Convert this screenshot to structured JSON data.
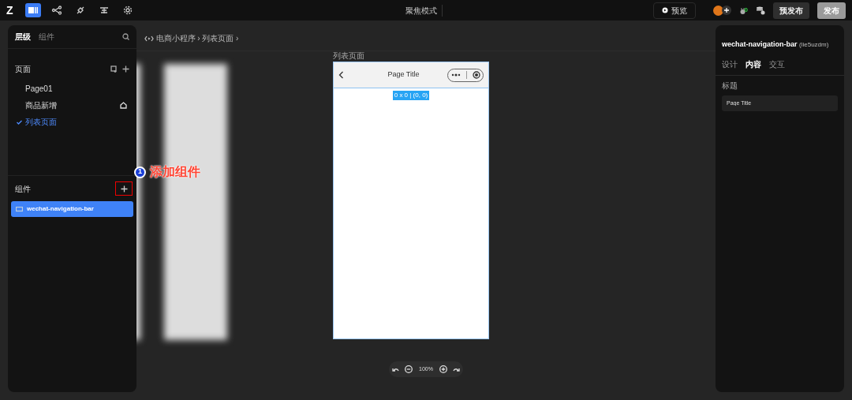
{
  "topbar": {
    "logo": "Z",
    "tools": [
      {
        "kind": "layout",
        "selected": true
      },
      {
        "kind": "flow",
        "selected": false
      },
      {
        "kind": "plugin",
        "selected": false
      },
      {
        "kind": "align",
        "selected": false
      },
      {
        "kind": "settings",
        "selected": false
      }
    ],
    "mode_label": "聚焦模式",
    "preview_button": "预览",
    "debug_badge": "0",
    "prepublish_button": "预发布",
    "publish_button": "发布"
  },
  "left_panel": {
    "tabs": [
      {
        "label": "层级",
        "selected": true
      },
      {
        "label": "组件",
        "selected": false
      }
    ],
    "pages_title": "页面",
    "pages": [
      {
        "label": "Page01",
        "selected": false,
        "home": false
      },
      {
        "label": "商品新增",
        "selected": false,
        "home": true
      },
      {
        "label": "列表页面",
        "selected": true,
        "home": false
      }
    ],
    "components_title": "组件",
    "components": [
      {
        "label": "wechat-navigation-bar",
        "selected": true
      }
    ]
  },
  "annotation": {
    "number": "1",
    "text": "添加组件"
  },
  "breadcrumb": {
    "items": [
      "电商小程序",
      "列表页面"
    ],
    "separator": "›"
  },
  "canvas": {
    "page_label": "列表页面",
    "nav_title": "Page Title",
    "size_badge": "0 x 0 | (0, 0)",
    "zoom": "100%"
  },
  "right_panel": {
    "component_name": "wechat-navigation-bar",
    "component_id": "(lie5uzdm)",
    "tabs": [
      {
        "label": "设计",
        "selected": false
      },
      {
        "label": "内容",
        "selected": true
      },
      {
        "label": "交互",
        "selected": false
      }
    ],
    "field_label": "标题",
    "field_value": "Page Title"
  }
}
